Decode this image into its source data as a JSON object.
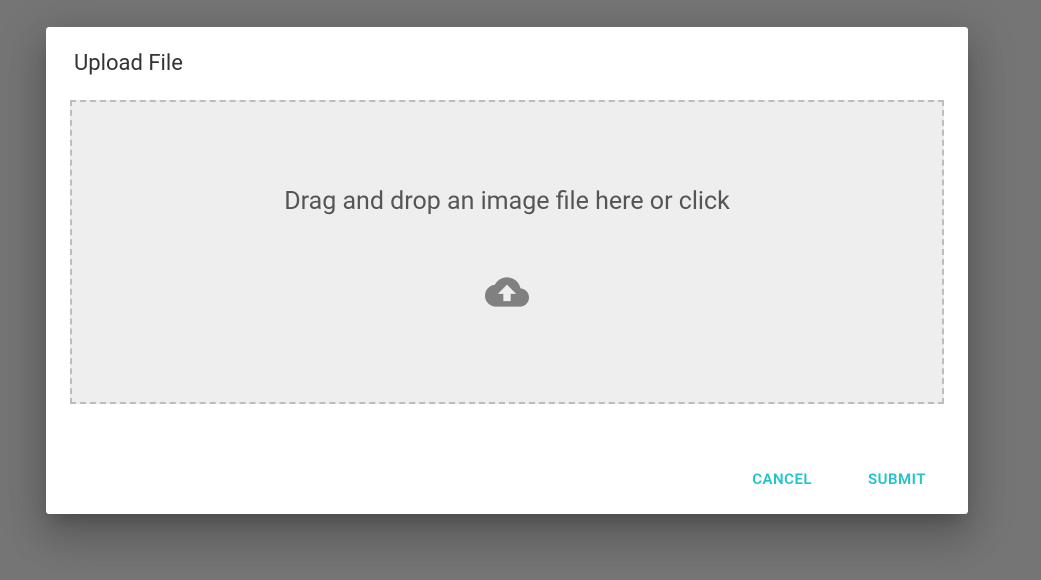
{
  "dialog": {
    "title": "Upload File",
    "dropzone_text": "Drag and drop an image file here or click",
    "cancel_label": "CANCEL",
    "submit_label": "SUBMIT"
  }
}
